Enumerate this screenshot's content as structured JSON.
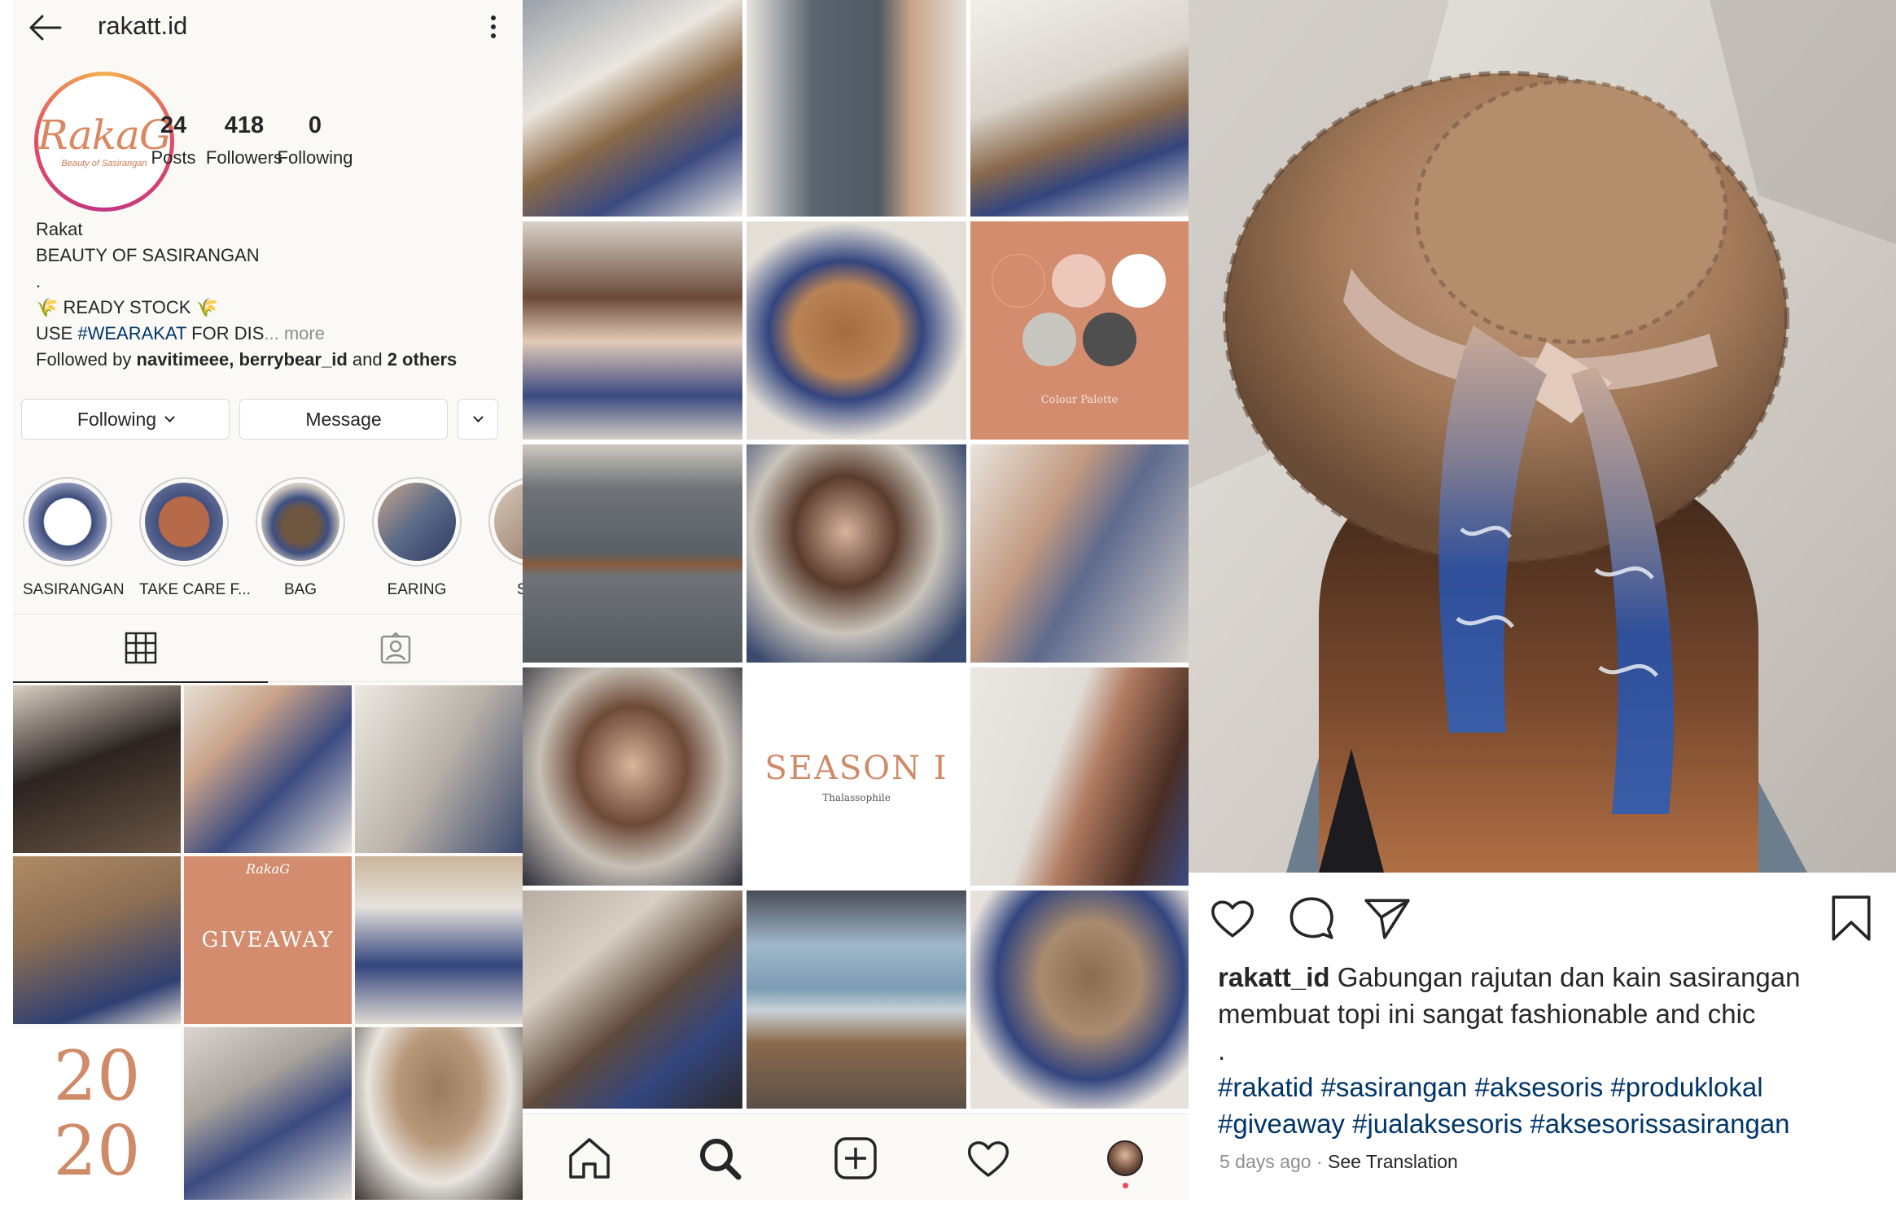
{
  "profile": {
    "username": "rakatt.id",
    "logo": {
      "word": "RakaG",
      "sub": "Beauty of Sasirangan"
    },
    "stats": [
      {
        "count": "24",
        "label": "Posts"
      },
      {
        "count": "418",
        "label": "Followers"
      },
      {
        "count": "0",
        "label": "Following"
      }
    ],
    "bio": {
      "name": "Rakat",
      "tagline": "BEAUTY OF SASIRANGAN",
      "dot": ".",
      "ready_stock": "🌾 READY STOCK 🌾",
      "use_prefix": "USE ",
      "hashtag": "#WEARAKAT",
      "use_suffix": " FOR DIS",
      "more": "... more",
      "followed_prefix": "Followed by ",
      "followed_names": "navitimeee, berrybear_id",
      "followed_and": " and ",
      "followed_others": "2 others"
    },
    "buttons": {
      "following": "Following",
      "message": "Message"
    },
    "highlights": [
      {
        "label": "SASIRANGAN",
        "color": "#3a4a78"
      },
      {
        "label": "TAKE CARE F...",
        "color": "#b76a4a"
      },
      {
        "label": "BAG",
        "color": "#6f5640"
      },
      {
        "label": "EARING",
        "color": "#5a6a88"
      },
      {
        "label": "SCR",
        "color": "#8a6e5c"
      }
    ],
    "grid_tiles": [
      {
        "bg": "#6a5646"
      },
      {
        "bg": "#3b4a80"
      },
      {
        "bg": "#b9b2a8"
      },
      {
        "bg": "#8c6e52"
      },
      {
        "bg": "#d38c6d",
        "text": "GIVEAWAY",
        "logo": "RakaG"
      },
      {
        "bg": "#33457e"
      },
      {
        "bg": "#ffffff",
        "text": "20 20"
      },
      {
        "bg": "#a9a39c"
      },
      {
        "bg": "#9b7b5e"
      }
    ]
  },
  "explore": {
    "tiles": [
      {
        "bg": "#c9c3b6"
      },
      {
        "bg": "#5a6570"
      },
      {
        "bg": "#d9d4cc"
      },
      {
        "bg": "#cfc9c1"
      },
      {
        "bg": "#d6d0c6"
      },
      {
        "bg": "#d38c6d",
        "caption": "Colour Palette"
      },
      {
        "bg": "#6f7377"
      },
      {
        "bg": "#cac4bb"
      },
      {
        "bg": "#d3cfc8"
      },
      {
        "bg": "#c7c0b6"
      },
      {
        "bg": "#ffffff",
        "title": "SEASON I",
        "subtitle": "Thalassophile"
      },
      {
        "bg": "#e0dcd6"
      },
      {
        "bg": "#b7aea3"
      },
      {
        "bg": "#8aa0b2"
      },
      {
        "bg": "#bfb7ad"
      }
    ],
    "palette_colors": [
      "#d38c6d",
      "#eec7bb",
      "#ffffff",
      "#c7c7bf",
      "#4f4f4f"
    ],
    "nav": [
      "home-icon",
      "search-icon",
      "add-post-icon",
      "activity-heart-icon",
      "profile-avatar"
    ]
  },
  "post": {
    "username": "rakatt_id",
    "caption": " Gabungan rajutan dan kain sasirangan membuat topi ini sangat fashionable and chic",
    "dot": ".",
    "hashtags": " #rakatid #sasirangan #aksesoris #produklokal #giveaway #jualaksesoris #aksesorissasirangan",
    "time": "5 days ago",
    "separator": " · ",
    "see_translation": "See Translation"
  },
  "colors": {
    "text": "#262626",
    "muted": "#8e8e8e",
    "hashtag": "#003569",
    "accent_terracotta": "#d38c6d",
    "sasirangan_blue": "#33457e"
  }
}
